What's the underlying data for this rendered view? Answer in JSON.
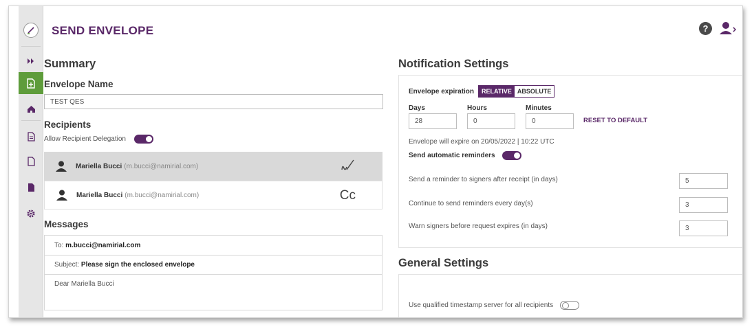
{
  "page": {
    "title": "SEND ENVELOPE"
  },
  "rail": {
    "items": [
      "logo-icon",
      "expand-icon",
      "new-envelope-icon",
      "home-icon",
      "document-icon",
      "file-icon",
      "archive-icon",
      "settings-icon"
    ]
  },
  "summary": {
    "heading": "Summary",
    "envelope_name_label": "Envelope Name",
    "envelope_name_value": "TEST QES",
    "recipients_label": "Recipients",
    "delegation_label": "Allow Recipient Delegation",
    "delegation_enabled": true,
    "recipients": [
      {
        "name": "Mariella Bucci",
        "email": "(m.bucci@namirial.com)",
        "role_icon": "signature-icon",
        "selected": true
      },
      {
        "name": "Mariella Bucci",
        "email": "(m.bucci@namirial.com)",
        "role_text": "Cc",
        "selected": false
      }
    ]
  },
  "messages": {
    "heading": "Messages",
    "to_label": "To:",
    "to_value": "m.bucci@namirial.com",
    "subject_label": "Subject:",
    "subject_value": "Please sign the enclosed envelope",
    "body": "Dear Mariella Bucci"
  },
  "notification": {
    "heading": "Notification Settings",
    "expiration_label": "Envelope expiration",
    "mode_relative": "RELATIVE",
    "mode_absolute": "ABSOLUTE",
    "mode_selected": "RELATIVE",
    "days_label": "Days",
    "hours_label": "Hours",
    "minutes_label": "Minutes",
    "days_value": "28",
    "hours_value": "0",
    "minutes_value": "0",
    "reset_label": "RESET TO DEFAULT",
    "expire_note": "Envelope will expire on 20/05/2022 | 10:22 UTC",
    "auto_reminders_label": "Send automatic reminders",
    "auto_reminders_enabled": true,
    "reminder_after_label": "Send a reminder to signers after receipt (in days)",
    "reminder_after_value": "5",
    "reminder_every_label": "Continue to send reminders every day(s)",
    "reminder_every_value": "3",
    "warn_label": "Warn signers before request expires (in days)",
    "warn_value": "3"
  },
  "general": {
    "heading": "General Settings",
    "qts_label": "Use qualified timestamp server for all recipients",
    "qts_enabled": false
  },
  "colors": {
    "brand": "#5a2868",
    "rail_active": "#5e9c3b"
  }
}
